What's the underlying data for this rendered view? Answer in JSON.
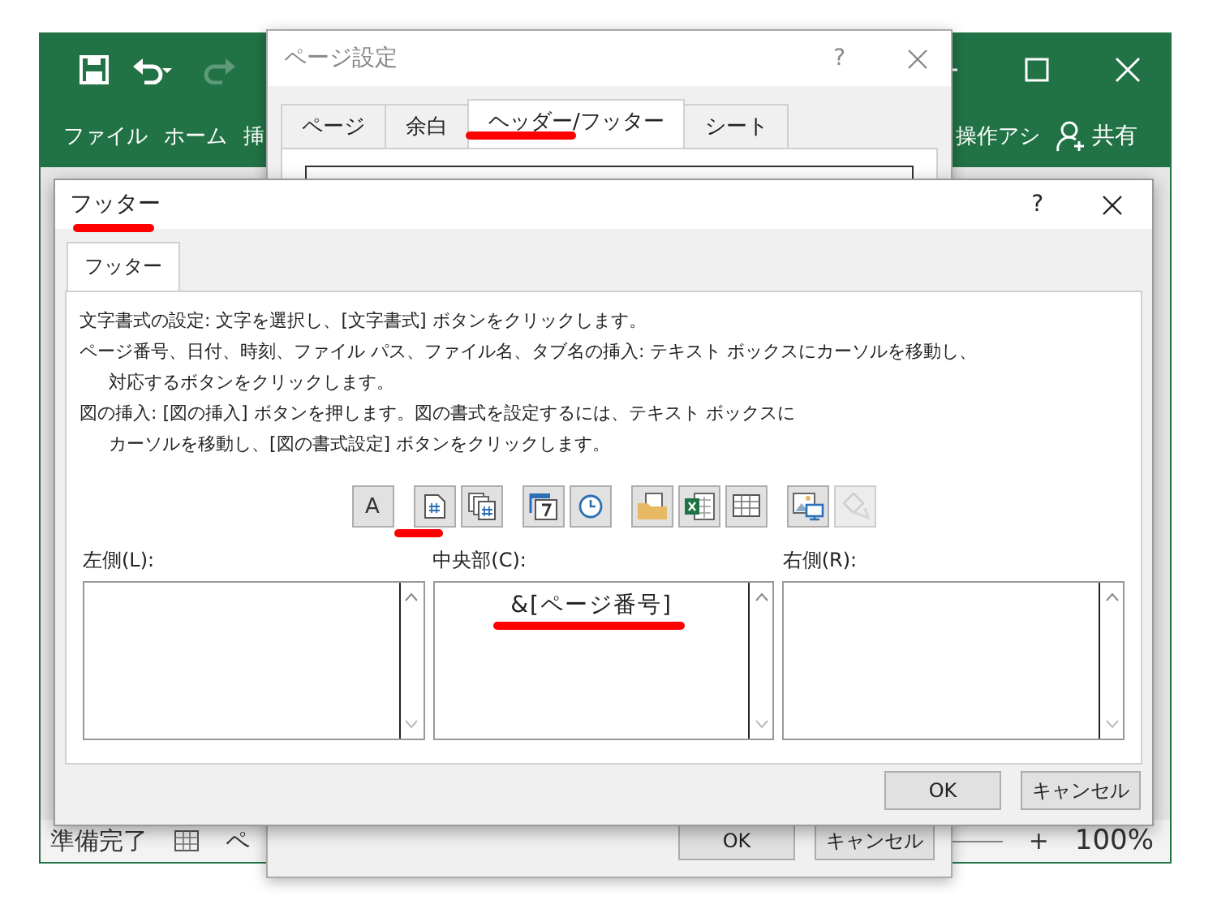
{
  "excel": {
    "ribbon_tabs": [
      "ファイル",
      "ホーム",
      "挿"
    ],
    "tell_me": "操作アシ",
    "share": "共有",
    "status_bar": {
      "ready": "準備完了",
      "view": "ペ",
      "zoom_in": "+",
      "zoom": "100%"
    }
  },
  "page_setup": {
    "title": "ページ設定",
    "help": "?",
    "tabs": [
      {
        "label": "ページ",
        "selected": false
      },
      {
        "label": "余白",
        "selected": false
      },
      {
        "label": "ヘッダー/フッター",
        "selected": true
      },
      {
        "label": "シート",
        "selected": false
      }
    ],
    "buttons": [
      "OK",
      "キャンセル"
    ]
  },
  "footer_dialog": {
    "title": "フッター",
    "help": "?",
    "tabs": [
      {
        "label": "フッター",
        "selected": true
      }
    ],
    "instructions": [
      [
        "文字書式の設定: 文字を選択し、[文字書式] ボタンをクリックします。"
      ],
      [
        "ページ番号、日付、時刻、ファイル パス、ファイル名、タブ名の挿入: テキスト ボックスにカーソルを移動し、",
        "対応するボタンをクリックします。"
      ],
      [
        "図の挿入: [図の挿入] ボタンを押します。図の書式を設定するには、テキスト ボックスに",
        "カーソルを移動し、[図の書式設定] ボタンをクリックします。"
      ]
    ],
    "toolbar": [
      [
        {
          "kind": "text",
          "label": "A",
          "disabled": false
        }
      ],
      [
        {
          "kind": "page-number",
          "disabled": false
        },
        {
          "kind": "page-count",
          "disabled": false
        }
      ],
      [
        {
          "kind": "date",
          "disabled": false
        },
        {
          "kind": "time",
          "disabled": false
        }
      ],
      [
        {
          "kind": "file-path",
          "disabled": false
        },
        {
          "kind": "file-name",
          "disabled": false
        },
        {
          "kind": "sheet-name",
          "disabled": false
        }
      ],
      [
        {
          "kind": "picture",
          "disabled": false
        },
        {
          "kind": "format-picture",
          "disabled": true
        }
      ]
    ],
    "sections": [
      {
        "label": "左側(L):"
      },
      {
        "label": "中央部(C):",
        "value": "&[ページ番号]"
      },
      {
        "label": "右側(R):"
      }
    ],
    "buttons": [
      "OK",
      "キャンセル"
    ]
  }
}
